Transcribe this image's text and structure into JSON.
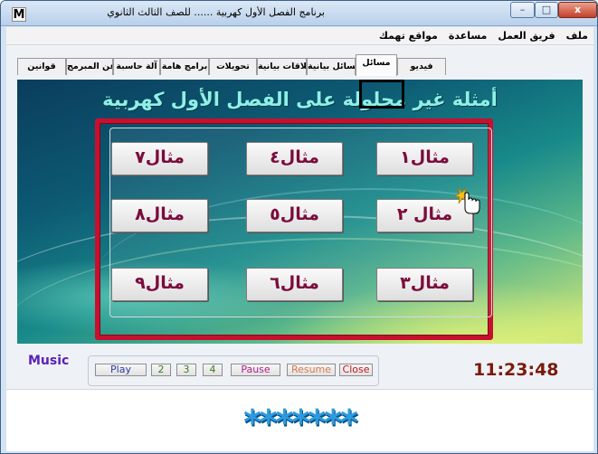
{
  "window": {
    "app_letter": "M",
    "title": "برنامج الفصل الأول كهربية ...... للصف الثالث الثانوي",
    "minimize_label": "–",
    "maximize_label": "□",
    "close_label": "x"
  },
  "menu": {
    "items": [
      {
        "label": "ملف"
      },
      {
        "label": "فريق العمل"
      },
      {
        "label": "مساعدة"
      },
      {
        "label": "مواقع تهمك"
      }
    ]
  },
  "tabs": [
    {
      "label": "فيديو"
    },
    {
      "label": "مسائل",
      "active": true
    },
    {
      "label": "مسائل بيانية"
    },
    {
      "label": "علاقات بيانية"
    },
    {
      "label": "تحويلات"
    },
    {
      "label": "برامج هامة"
    },
    {
      "label": "آلة حاسبة"
    },
    {
      "label": "عن المبرمج"
    },
    {
      "label": "قوانين"
    }
  ],
  "stage": {
    "heading": "أمثلة غير محلولة على الفصل الأول كهربية"
  },
  "examples": [
    {
      "label": "مثال١"
    },
    {
      "label": "مثال٤"
    },
    {
      "label": "مثال٧"
    },
    {
      "label": "مثال ٢"
    },
    {
      "label": "مثال٥"
    },
    {
      "label": "مثال٨"
    },
    {
      "label": "مثال٣"
    },
    {
      "label": "مثال٦"
    },
    {
      "label": "مثال٩"
    }
  ],
  "music": {
    "label": "Music",
    "buttons": {
      "play": "Play",
      "track2": "2",
      "track3": "3",
      "track4": "4",
      "pause": "Pause",
      "resume": "Resume",
      "close": "Close"
    },
    "colors": {
      "play": "#2a3aa8",
      "track": "#3a7a1e",
      "pause": "#b0208c",
      "resume": "#d8784a",
      "close": "#c01818"
    }
  },
  "clock": "11:23:48",
  "footer": {
    "stars": "*******"
  },
  "colors": {
    "accent_red": "#c8102e",
    "button_text": "#7b0c3c",
    "heading": "#8ff0e6"
  },
  "icons": {
    "cursor": "hand-pointer-icon"
  }
}
